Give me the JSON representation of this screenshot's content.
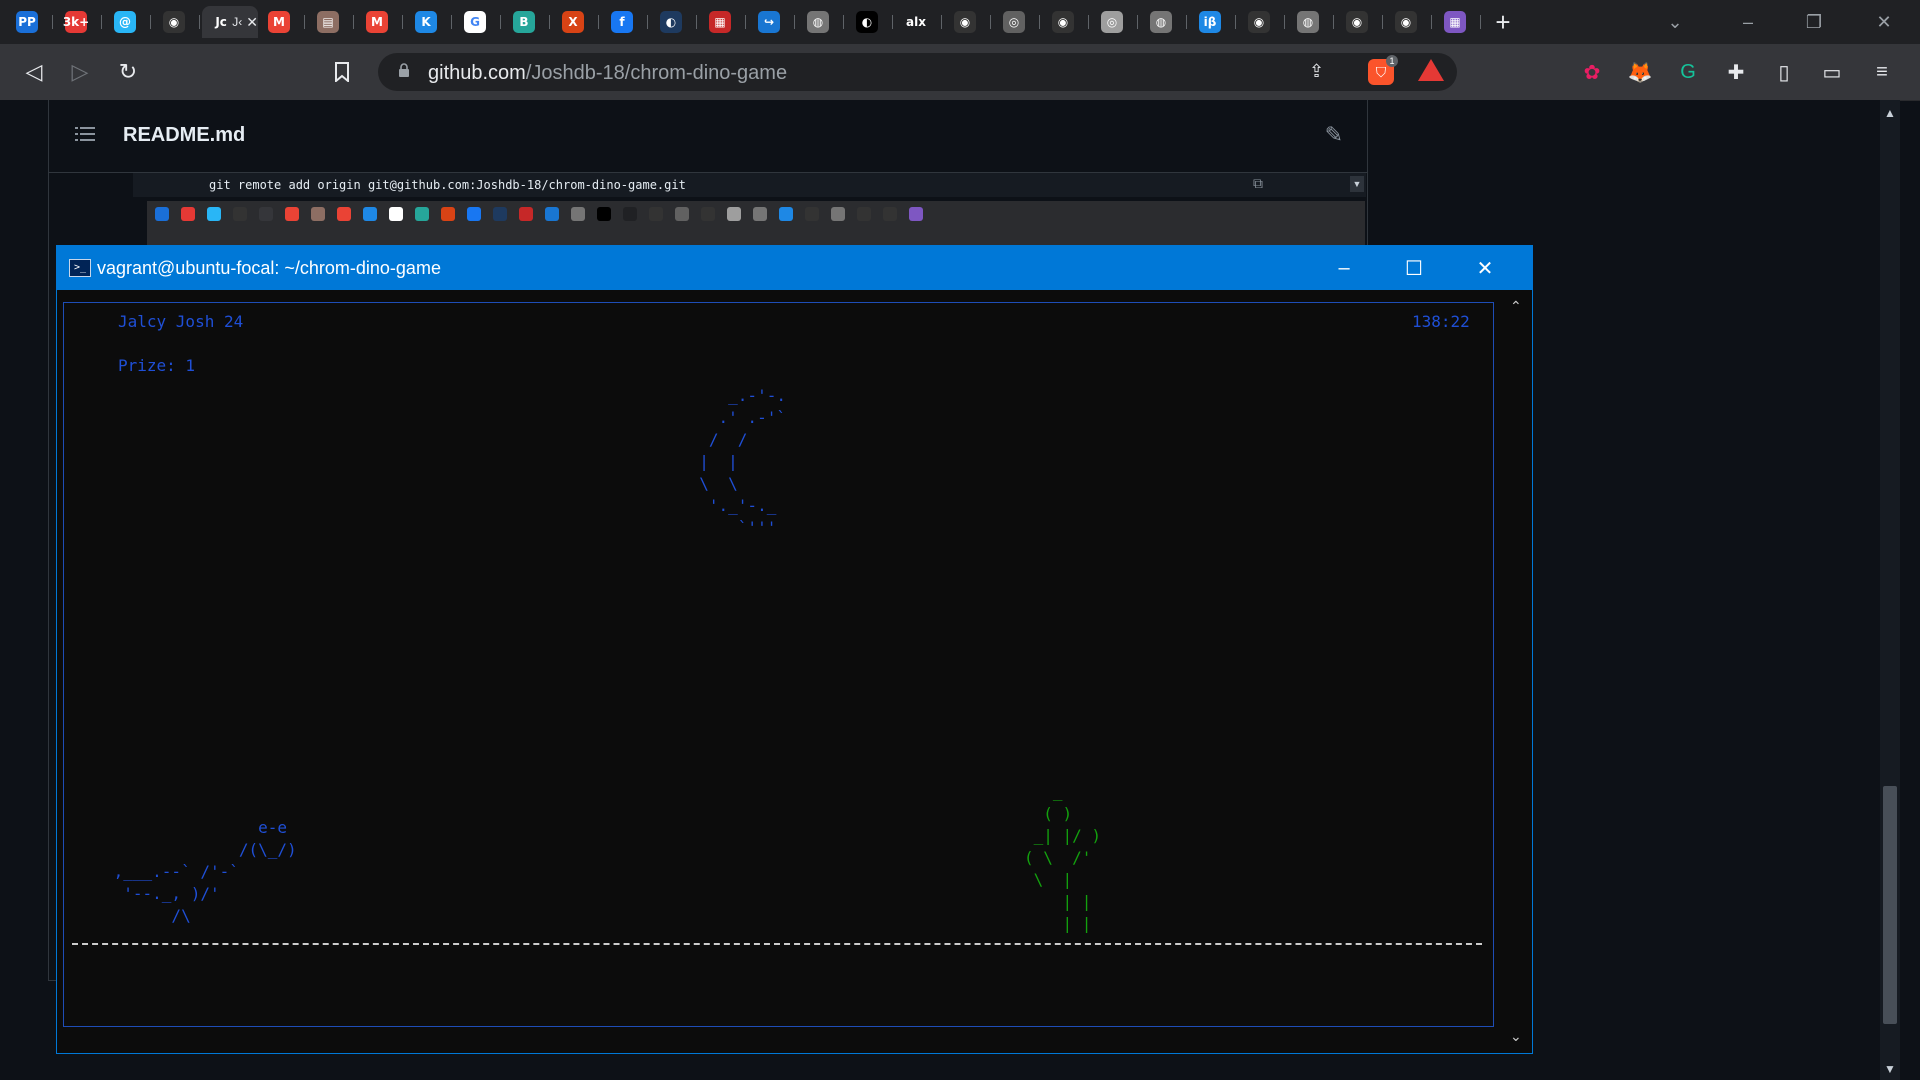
{
  "browser": {
    "tabs": [
      {
        "icon": "pp-icon",
        "glyph": "PP",
        "color": "#1a6fd8"
      },
      {
        "icon": "badge-3k-icon",
        "glyph": "3k+",
        "color": "#e53935"
      },
      {
        "icon": "blue-bird-icon",
        "glyph": "@",
        "color": "#29b6f6"
      },
      {
        "icon": "github-icon",
        "glyph": "◉",
        "color": "#333333"
      },
      {
        "icon": "active-tab-icon",
        "glyph": "Jc",
        "color": "#35363a",
        "active": true
      },
      {
        "icon": "gmail-icon",
        "glyph": "M",
        "color": "#ea4335"
      },
      {
        "icon": "doc-icon",
        "glyph": "▤",
        "color": "#8d6e63"
      },
      {
        "icon": "gmail-icon",
        "glyph": "M",
        "color": "#ea4335"
      },
      {
        "icon": "k-icon",
        "glyph": "K",
        "color": "#1e88e5"
      },
      {
        "icon": "google-icon",
        "glyph": "G",
        "color": "#ffffff"
      },
      {
        "icon": "b-icon",
        "glyph": "B",
        "color": "#26a69a"
      },
      {
        "icon": "x-icon",
        "glyph": "X",
        "color": "#d84315"
      },
      {
        "icon": "facebook-icon",
        "glyph": "f",
        "color": "#1877f2"
      },
      {
        "icon": "blue-sphere-icon",
        "glyph": "◐",
        "color": "#1e3a5f"
      },
      {
        "icon": "red-box-icon",
        "glyph": "▦",
        "color": "#c62828"
      },
      {
        "icon": "arrow-icon",
        "glyph": "↪",
        "color": "#1976d2"
      },
      {
        "icon": "globe-icon",
        "glyph": "◍",
        "color": "#757575"
      },
      {
        "icon": "moon-icon",
        "glyph": "◐",
        "color": "#000000"
      },
      {
        "icon": "alx-icon",
        "glyph": "alx",
        "color": "#202124"
      },
      {
        "icon": "github-icon",
        "glyph": "◉",
        "color": "#333333"
      },
      {
        "icon": "disc-icon",
        "glyph": "◎",
        "color": "#616161"
      },
      {
        "icon": "github-icon",
        "glyph": "◉",
        "color": "#333333"
      },
      {
        "icon": "circle-icon",
        "glyph": "◎",
        "color": "#9e9e9e"
      },
      {
        "icon": "globe-icon",
        "glyph": "◍",
        "color": "#757575"
      },
      {
        "icon": "ib-icon",
        "glyph": "iβ",
        "color": "#1e88e5"
      },
      {
        "icon": "github-icon",
        "glyph": "◉",
        "color": "#333333"
      },
      {
        "icon": "globe-icon",
        "glyph": "◍",
        "color": "#757575"
      },
      {
        "icon": "github-icon",
        "glyph": "◉",
        "color": "#333333"
      },
      {
        "icon": "github-icon",
        "glyph": "◉",
        "color": "#333333"
      },
      {
        "icon": "grid-icon",
        "glyph": "▦",
        "color": "#7e57c2"
      }
    ],
    "active_tab_text": "J‹",
    "new_tab": "+",
    "url_host": "github.com",
    "url_path": "/Joshdb-18/chrom-dino-game",
    "window_controls": {
      "dropdown": "⌄",
      "minimize": "–",
      "restore": "❐",
      "close": "✕"
    },
    "brave_badge": "1"
  },
  "github": {
    "readme_title": "README.md",
    "code_line": "git remote add origin git@github.com:Joshdb-18/chrom-dino-game.git"
  },
  "terminal": {
    "title": "vagrant@ubuntu-focal: ~/chrom-dino-game",
    "player": "Jalcy Josh 24",
    "timer": "138:22",
    "prize": "Prize: 1",
    "moon_art": "     _.-'-.\n    .' .-'`\n   /  /\n  |  |\n  \\  \\\n   '._'-._\n      `'''",
    "dino_art": "                e-e\n              /(\\_/)\n ,___.--` /'-`\n  '--._, )/'\n       /\\",
    "cactus_art": "   _\n  ( )\n _| |/ )\n( \\  /'\n \\  |\n    | |\n    | |",
    "colors": {
      "title_bar": "#0078d7",
      "art_blue": "#1f4fd6",
      "cactus_green": "#13a10e"
    }
  }
}
